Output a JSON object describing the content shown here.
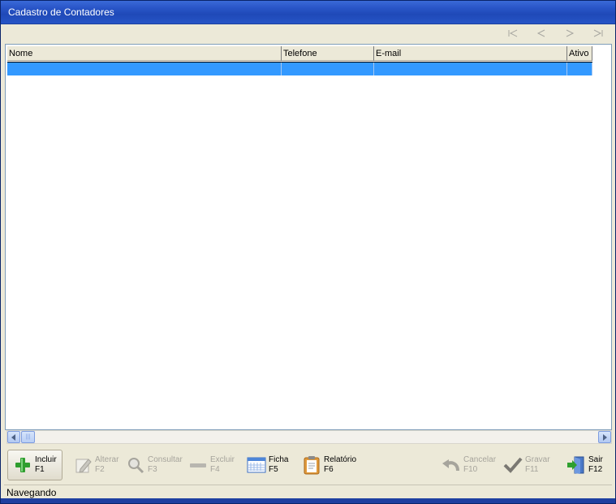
{
  "window": {
    "title": "Cadastro de Contadores"
  },
  "navigator": {
    "buttons": [
      {
        "name": "first-record-button",
        "icon": "first-record-icon"
      },
      {
        "name": "prior-record-button",
        "icon": "prior-record-icon"
      },
      {
        "name": "next-record-button",
        "icon": "next-record-icon"
      },
      {
        "name": "last-record-button",
        "icon": "last-record-icon"
      }
    ]
  },
  "grid": {
    "columns": [
      "Nome",
      "Telefone",
      "E-mail",
      "Ativo"
    ],
    "rows": [
      [
        "",
        "",
        "",
        ""
      ]
    ],
    "selected_row_color": "#3399ff"
  },
  "toolbar": {
    "incluir": {
      "label": "Incluir",
      "key": "F1"
    },
    "alterar": {
      "label": "Alterar",
      "key": "F2"
    },
    "consultar": {
      "label": "Consultar",
      "key": "F3"
    },
    "excluir": {
      "label": "Excluir",
      "key": "F4"
    },
    "ficha": {
      "label": "Ficha",
      "key": "F5"
    },
    "relatorio": {
      "label": "Relatório",
      "key": "F6"
    },
    "cancelar": {
      "label": "Cancelar",
      "key": "F10"
    },
    "gravar": {
      "label": "Gravar",
      "key": "F11"
    },
    "sair": {
      "label": "Sair",
      "key": "F12"
    }
  },
  "status": {
    "text": "Navegando"
  },
  "colors": {
    "titlebar": "#2a56c8",
    "face": "#ece9d8",
    "selection": "#3399ff"
  }
}
